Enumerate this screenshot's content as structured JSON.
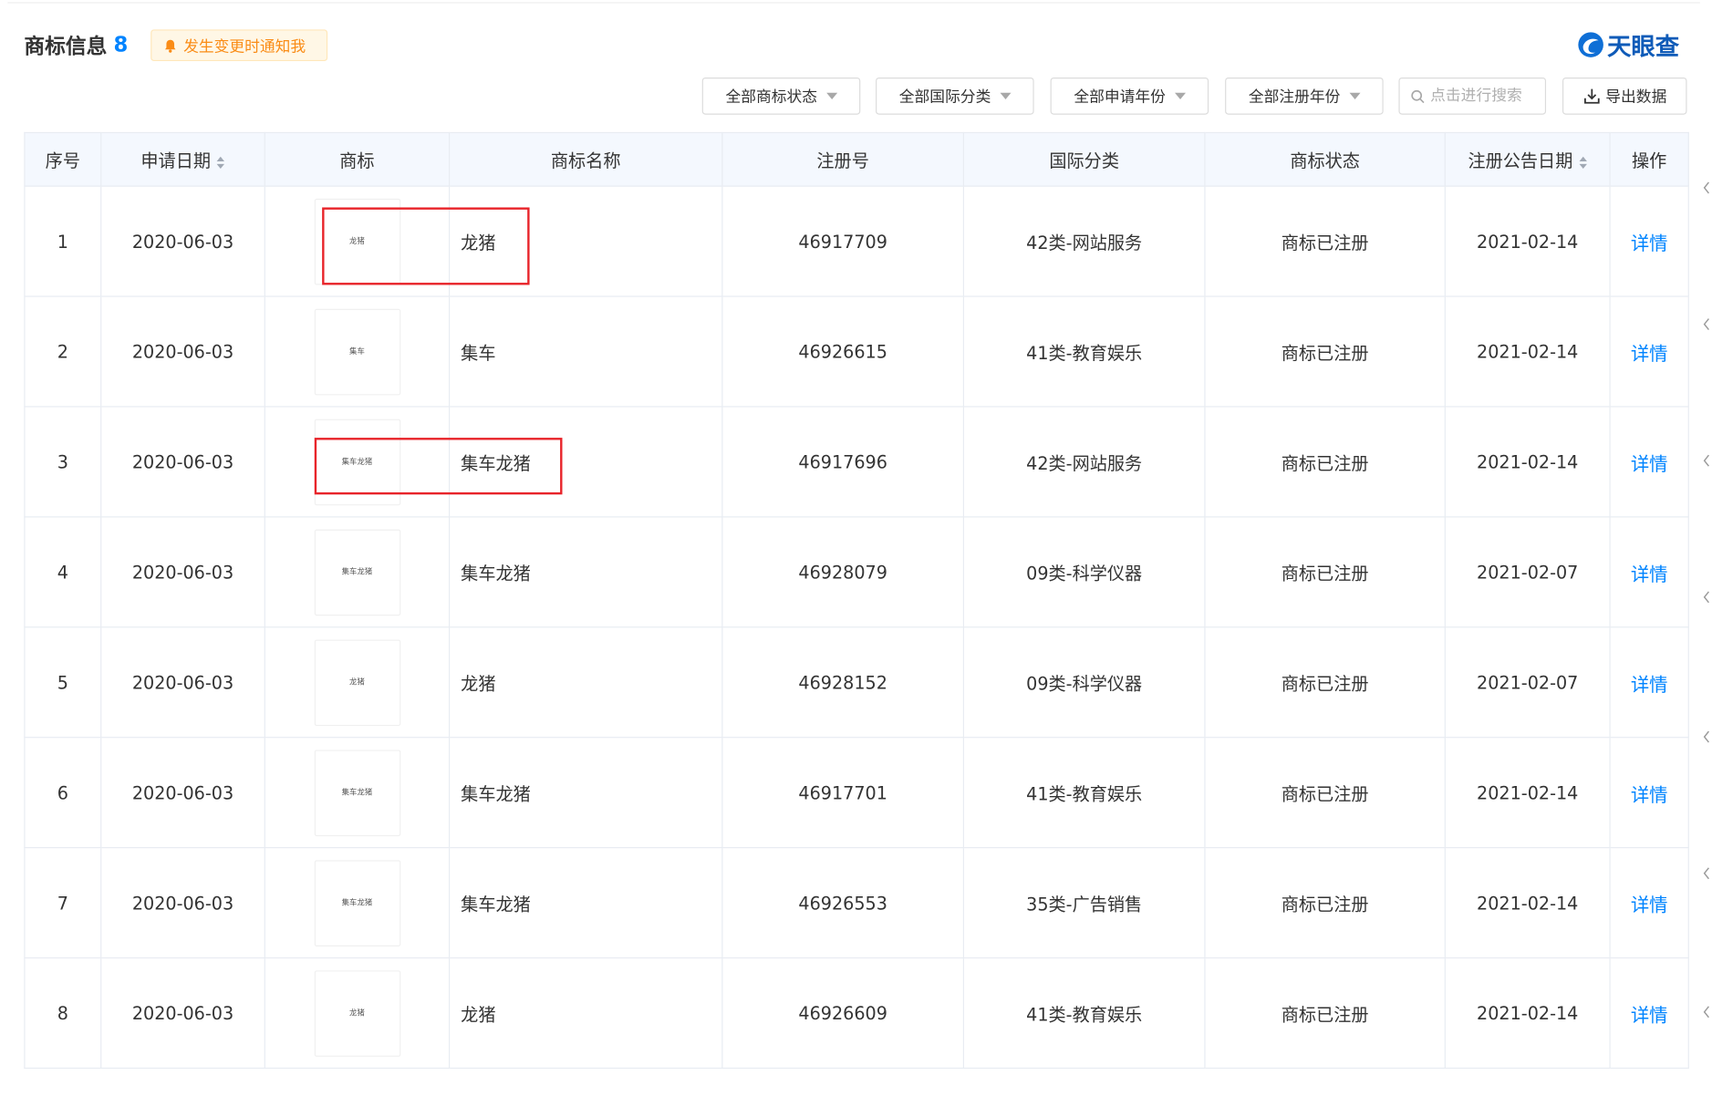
{
  "section": {
    "title": "商标信息",
    "count": "8",
    "notify_label": "发生变更时通知我",
    "logo_text": "天眼查"
  },
  "filters": [
    {
      "label": "全部商标状态"
    },
    {
      "label": "全部国际分类"
    },
    {
      "label": "全部申请年份"
    },
    {
      "label": "全部注册年份"
    }
  ],
  "search": {
    "placeholder": "点击进行搜索"
  },
  "export_label": "导出数据",
  "table": {
    "columns": [
      "序号",
      "申请日期",
      "商标",
      "商标名称",
      "注册号",
      "国际分类",
      "商标状态",
      "注册公告日期",
      "操作"
    ],
    "rows": [
      {
        "index": "1",
        "apply_date": "2020-06-03",
        "logo_text": "龙猪",
        "name": "龙猪",
        "reg_no": "46917709",
        "class": "42类-网站服务",
        "status": "商标已注册",
        "pub_date": "2021-02-14",
        "action": "详情"
      },
      {
        "index": "2",
        "apply_date": "2020-06-03",
        "logo_text": "集车",
        "name": "集车",
        "reg_no": "46926615",
        "class": "41类-教育娱乐",
        "status": "商标已注册",
        "pub_date": "2021-02-14",
        "action": "详情"
      },
      {
        "index": "3",
        "apply_date": "2020-06-03",
        "logo_text": "集车龙猪",
        "name": "集车龙猪",
        "reg_no": "46917696",
        "class": "42类-网站服务",
        "status": "商标已注册",
        "pub_date": "2021-02-14",
        "action": "详情"
      },
      {
        "index": "4",
        "apply_date": "2020-06-03",
        "logo_text": "集车龙猪",
        "name": "集车龙猪",
        "reg_no": "46928079",
        "class": "09类-科学仪器",
        "status": "商标已注册",
        "pub_date": "2021-02-07",
        "action": "详情"
      },
      {
        "index": "5",
        "apply_date": "2020-06-03",
        "logo_text": "龙猪",
        "name": "龙猪",
        "reg_no": "46928152",
        "class": "09类-科学仪器",
        "status": "商标已注册",
        "pub_date": "2021-02-07",
        "action": "详情"
      },
      {
        "index": "6",
        "apply_date": "2020-06-03",
        "logo_text": "集车龙猪",
        "name": "集车龙猪",
        "reg_no": "46917701",
        "class": "41类-教育娱乐",
        "status": "商标已注册",
        "pub_date": "2021-02-14",
        "action": "详情"
      },
      {
        "index": "7",
        "apply_date": "2020-06-03",
        "logo_text": "集车龙猪",
        "name": "集车龙猪",
        "reg_no": "46926553",
        "class": "35类-广告销售",
        "status": "商标已注册",
        "pub_date": "2021-02-14",
        "action": "详情"
      },
      {
        "index": "8",
        "apply_date": "2020-06-03",
        "logo_text": "龙猪",
        "name": "龙猪",
        "reg_no": "46926609",
        "class": "41类-教育娱乐",
        "status": "商标已注册",
        "pub_date": "2021-02-14",
        "action": "详情"
      }
    ]
  },
  "colors": {
    "accent": "#0084ff",
    "header_bg": "#f4f8fe",
    "notify_bg": "#fff7e6",
    "notify_text": "#fa8c16",
    "highlight_box": "#e8242a"
  }
}
